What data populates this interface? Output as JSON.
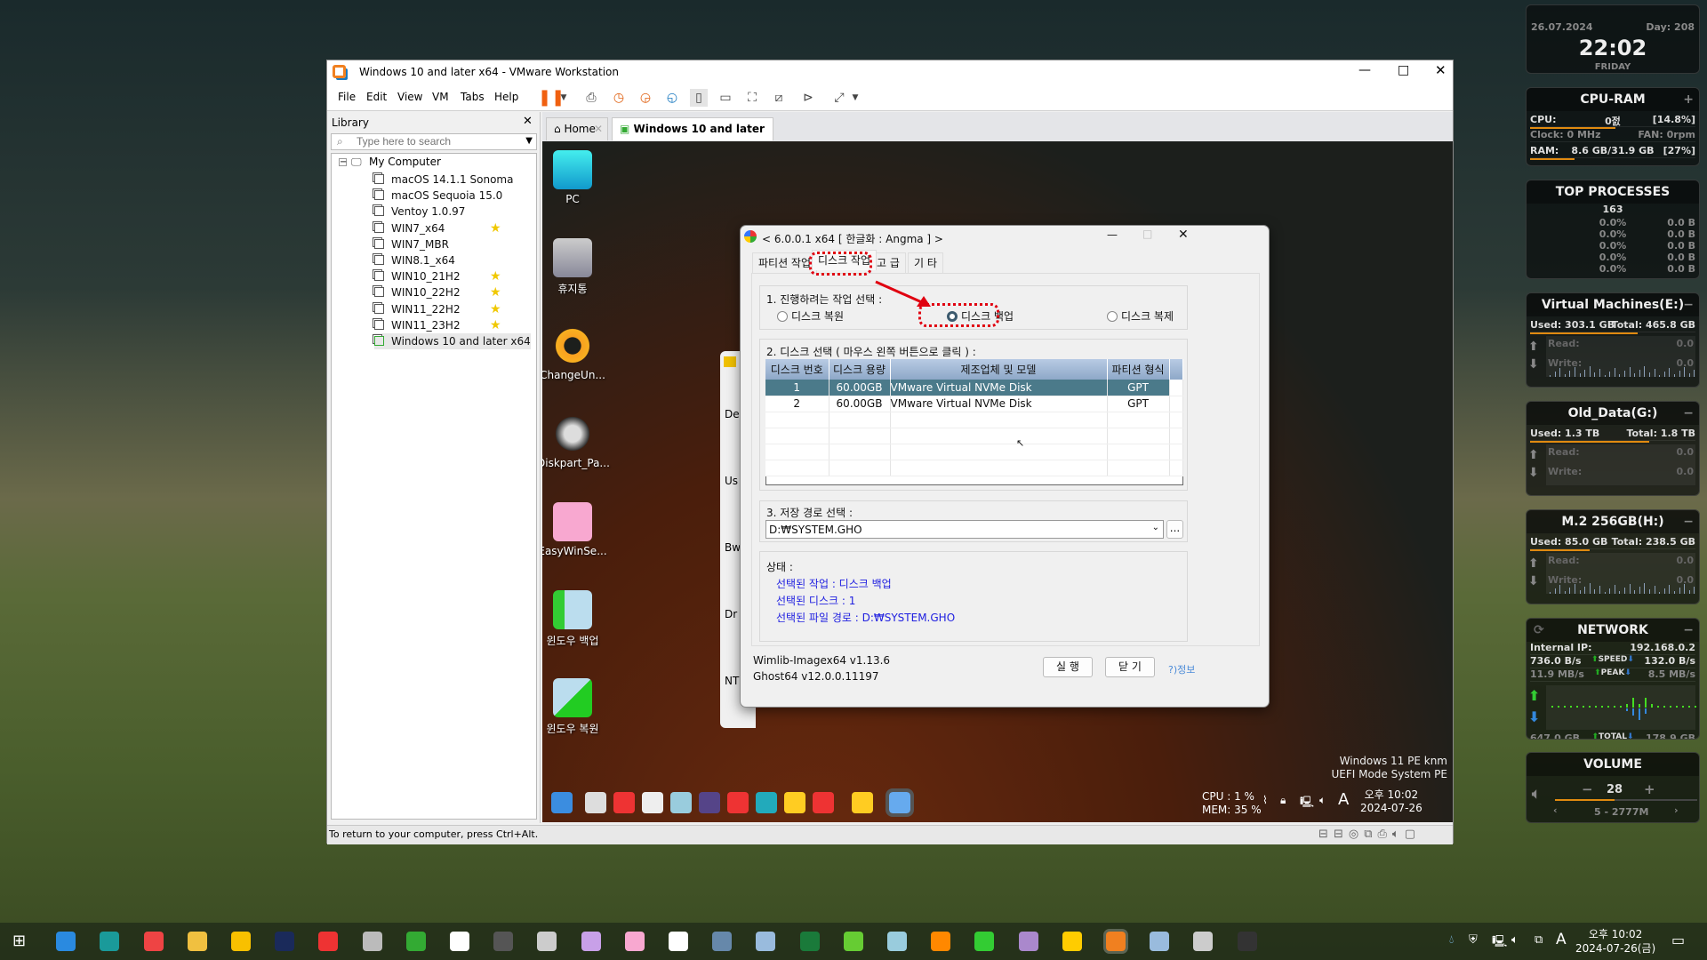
{
  "vmware": {
    "title": "Windows 10 and later x64 - VMware Workstation",
    "menu": [
      "File",
      "Edit",
      "View",
      "VM",
      "Tabs",
      "Help"
    ],
    "library": {
      "title": "Library",
      "search_placeholder": "Type here to search",
      "root": "My Computer",
      "items": [
        {
          "name": "macOS 14.1.1 Sonoma",
          "fav": false
        },
        {
          "name": "macOS Sequoia 15.0",
          "fav": false
        },
        {
          "name": "Ventoy 1.0.97",
          "fav": false
        },
        {
          "name": "WIN7_x64",
          "fav": true
        },
        {
          "name": "WIN7_MBR",
          "fav": false
        },
        {
          "name": "WIN8.1_x64",
          "fav": false
        },
        {
          "name": "WIN10_21H2",
          "fav": true
        },
        {
          "name": "WIN10_22H2",
          "fav": true
        },
        {
          "name": "WIN11_22H2",
          "fav": true
        },
        {
          "name": "WIN11_23H2",
          "fav": true
        },
        {
          "name": "Windows 10 and later x64",
          "fav": false,
          "running": true
        }
      ]
    },
    "tabs": [
      "Home",
      "Windows 10 and later x64"
    ],
    "status": "To return to your computer, press Ctrl+Alt."
  },
  "guest": {
    "desktop_icons": [
      "PC",
      "휴지통",
      "ChangeUn...",
      "Diskpart_Pa...",
      "EasyWinSe...",
      "윈도우 백업",
      "윈도우 복원"
    ],
    "behind_window_fragments": [
      "De",
      "Us",
      "Bw",
      "Dr",
      "NT"
    ],
    "watermark": [
      "Windows 11 PE knm",
      "UEFI Mode System PE"
    ],
    "cpu": "CPU :   1 %",
    "mem": "MEM: 35 %",
    "time": "오후 10:02",
    "date": "2024-07-26",
    "ime": "A"
  },
  "dialog": {
    "title": "< 6.0.0.1 x64 [ 한글화 : Angma ] >",
    "tabs": [
      "파티션 작업",
      "디스크 작업",
      "고 급",
      "기 타"
    ],
    "active_tab": "디스크 작업",
    "section1": {
      "label": "1. 진행하려는 작업 선택 :",
      "options": [
        "디스크 복원",
        "디스크 백업",
        "디스크 복제"
      ],
      "selected": "디스크 백업"
    },
    "section2": {
      "label": "2. 디스크 선택 ( 마우스 왼쪽 버튼으로 클릭 ) :",
      "columns": [
        "디스크 번호",
        "디스크 용량",
        "제조업체 및 모델",
        "파티션 형식"
      ],
      "rows": [
        [
          "1",
          "60.00GB",
          "VMware Virtual NVMe Disk",
          "GPT"
        ],
        [
          "2",
          "60.00GB",
          "VMware Virtual NVMe Disk",
          "GPT"
        ]
      ],
      "selected_row": 0
    },
    "section3": {
      "label": "3. 저장 경로 선택 :",
      "path": "D:₩SYSTEM.GHO",
      "browse": "..."
    },
    "status": {
      "label": "상태 :",
      "lines": [
        "선택된 작업 : 디스크 백업",
        "선택된 디스크 :   1",
        "선택된 파일 경로 : D:₩SYSTEM.GHO"
      ]
    },
    "versions": [
      "Wimlib-Imagex64 v1.13.6",
      "Ghost64 v12.0.0.11197"
    ],
    "run": "실 행",
    "close": "닫 기",
    "info": "?)정보",
    "highlight_color": "#e00010"
  },
  "widgets": {
    "clock": {
      "date": "26.07.2024",
      "day": "Day: 208",
      "time": "22:02",
      "weekday": "FRIDAY"
    },
    "cpu_ram": {
      "title": "CPU-RAM",
      "cpu_label": "CPU:",
      "cpu_name": "0젌",
      "cpu_pct": "[14.8%]",
      "clock": "Clock: 0 MHz",
      "fan": "FAN: 0rpm",
      "ram_label": "RAM:",
      "ram": "8.6 GB/31.9 GB",
      "ram_pct": "[27%]",
      "cpu_fill": 0.148,
      "ram_fill": 0.27
    },
    "top": {
      "title": "TOP PROCESSES",
      "count": "163",
      "rows": [
        [
          "0.0%",
          "0.0 B"
        ],
        [
          "0.0%",
          "0.0 B"
        ],
        [
          "0.0%",
          "0.0 B"
        ],
        [
          "0.0%",
          "0.0 B"
        ],
        [
          "0.0%",
          "0.0 B"
        ]
      ]
    },
    "drives": [
      {
        "title": "Virtual Machines(E:)",
        "used": "Used: 303.1 GB",
        "total": "Total: 465.8 GB",
        "read": "Read:",
        "write": "Write:",
        "rv": "0.0",
        "wv": "0.0",
        "fill": 0.65
      },
      {
        "title": "Old_Data(G:)",
        "used": "Used: 1.3 TB",
        "total": "Total: 1.8 TB",
        "read": "Read:",
        "write": "Write:",
        "rv": "0.0",
        "wv": "0.0",
        "fill": 0.72
      },
      {
        "title": "M.2 256GB(H:)",
        "used": "Used: 85.0 GB",
        "total": "Total: 238.5 GB",
        "read": "Read:",
        "write": "Write:",
        "rv": "0.0",
        "wv": "0.0",
        "fill": 0.36
      }
    ],
    "network": {
      "title": "NETWORK",
      "ip_label": "Internal IP:",
      "ip": "192.168.0.2",
      "up_speed": "736.0 B/s",
      "speed": "SPEED",
      "down_speed": "132.0 B/s",
      "up_peak": "11.9 MB/s",
      "peak": "PEAK",
      "down_peak": "8.5 MB/s",
      "up_total": "647.0 GB",
      "total": "TOTAL",
      "down_total": "178.9 GB"
    },
    "volume": {
      "title": "VOLUME",
      "minus": "−",
      "level": "28",
      "plus": "+",
      "track": "5 - 2777M",
      "fill": 0.28
    }
  },
  "taskbar": {
    "time": "오후 10:02",
    "date": "2024-07-26(금)",
    "ime": "A",
    "apps": [
      "start",
      "internet-explorer",
      "edge",
      "chrome",
      "file-explorer",
      "app-a",
      "photoshop",
      "app-red",
      "app-tool",
      "app-c",
      "app-c2",
      "obs",
      "app-diamond",
      "app-i",
      "app-pink",
      "app-d",
      "app-person",
      "app-bird",
      "excel",
      "app-green",
      "app-notes",
      "app-key",
      "app-green2",
      "app-disc",
      "kakaotalk",
      "vmware",
      "app-folder",
      "app-monitor",
      "terminal"
    ]
  }
}
